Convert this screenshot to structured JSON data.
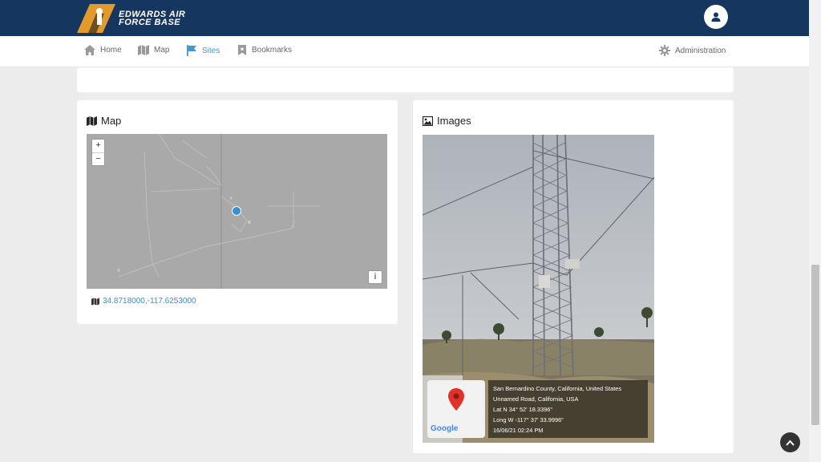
{
  "header": {
    "logo_line1": "EDWARDS AIR",
    "logo_line2": "FORCE BASE"
  },
  "nav": {
    "items": [
      {
        "label": "Home",
        "icon": "home-icon"
      },
      {
        "label": "Map",
        "icon": "map-icon"
      },
      {
        "label": "Sites",
        "icon": "flag-icon",
        "active": true
      },
      {
        "label": "Bookmarks",
        "icon": "bookmark-icon"
      }
    ],
    "admin_label": "Administration"
  },
  "map_card": {
    "title": "Map",
    "zoom_in": "+",
    "zoom_out": "−",
    "info": "i",
    "coords": "34.8718000,-117.6253000"
  },
  "images_card": {
    "title": "Images",
    "geotag": {
      "line1": "San Bernardino County, California, United States",
      "line2": "Unnamed Road, California, USA",
      "line3": "Lat N 34° 52' 18.3396\"",
      "line4": "Long W -117° 37' 33.9996\"",
      "line5": "16/06/21 02:24 PM",
      "google": "Google"
    }
  },
  "colors": {
    "header_bg": "#15375f",
    "accent": "#3a9ad9",
    "map_bg": "#a9a9a9",
    "marker": "#3a8fd0"
  }
}
